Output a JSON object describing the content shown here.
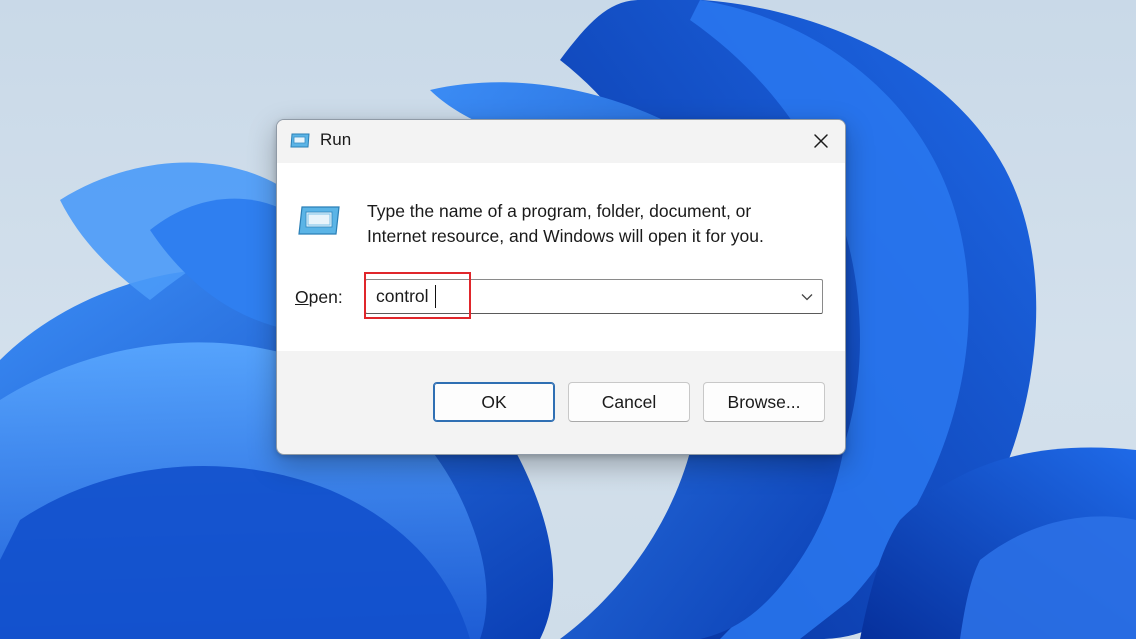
{
  "dialog": {
    "title": "Run",
    "close_icon": "close-icon",
    "app_icon": "run-icon",
    "description_line1": "Type the name of a program, folder, document, or",
    "description_line2": "Internet resource, and Windows will open it for you.",
    "open_label": "Open:",
    "open_value": "control",
    "dropdown_icon": "chevron-down-icon",
    "buttons": {
      "ok": "OK",
      "cancel": "Cancel",
      "browse": "Browse..."
    }
  },
  "colors": {
    "highlight_border": "#e0262b",
    "wallpaper_blue": "#1660e0",
    "desktop_background": "#cddcea",
    "dialog_background": "#f3f3f3",
    "ok_border": "#2f6fb3"
  }
}
